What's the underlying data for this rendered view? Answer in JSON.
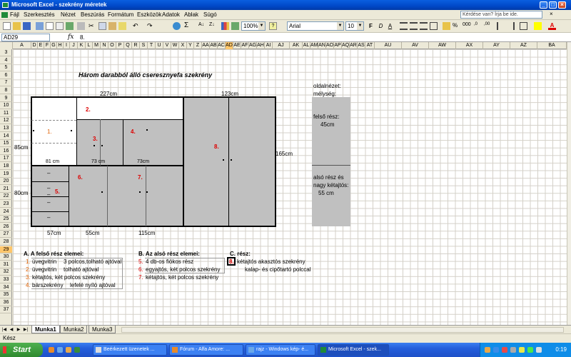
{
  "window": {
    "title": "Microsoft Excel - szekrény méretek"
  },
  "menu": {
    "items": [
      "Fájl",
      "Szerkesztés",
      "Nézet",
      "Beszúrás",
      "Formátum",
      "Eszközök",
      "Adatok",
      "Ablak",
      "Súgó"
    ],
    "help_placeholder": "Kérdése van? Írja be ide."
  },
  "toolbar": {
    "zoom": "100%",
    "font": "Arial",
    "font_size": "10",
    "bold": "F",
    "italic": "D",
    "underline": "A",
    "font_color_letter": "A"
  },
  "formula_bar": {
    "name_box": "AD29",
    "fx": "fx",
    "value": "8."
  },
  "columns": [
    "A",
    "D",
    "E",
    "F",
    "G",
    "H",
    "I",
    "J",
    "K",
    "L",
    "M",
    "N",
    "O",
    "P",
    "Q",
    "R",
    "S",
    "T",
    "U",
    "V",
    "W",
    "X",
    "Y",
    "Z",
    "AA",
    "AB",
    "AC",
    "AD",
    "AE",
    "AF",
    "AG",
    "AH",
    "AI",
    "AJ",
    "AK",
    "AL",
    "AM",
    "AN",
    "AO",
    "AP",
    "AQ",
    "AR",
    "AS",
    "AT",
    "AU",
    "AV",
    "AW",
    "AX",
    "AY",
    "AZ",
    "BA"
  ],
  "rows": [
    "3",
    "4",
    "5",
    "6",
    "7",
    "8",
    "9",
    "10",
    "11",
    "12",
    "13",
    "14",
    "15",
    "16",
    "17",
    "18",
    "19",
    "20",
    "21",
    "22",
    "23",
    "24",
    "25",
    "26",
    "27",
    "28",
    "29",
    "30",
    "31",
    "32",
    "33",
    "34",
    "35",
    "36",
    "37"
  ],
  "selected_row": "29",
  "sheet": {
    "title": "Három darabból álló cseresznyefa szekrény",
    "dims": {
      "top_left": "227cm",
      "top_right": "123cm",
      "left_upper": "85cm",
      "left_lower": "80cm",
      "right_height": "165cm",
      "w81": "81 cm",
      "w73a": "73 cm",
      "w73b": "73cm",
      "bottom_57": "57cm",
      "bottom_55": "55cm",
      "bottom_115": "115cm"
    },
    "labels": {
      "n1": "1.",
      "n2": "2.",
      "n3": "3.",
      "n4": "4.",
      "n5": "5.",
      "n6": "6.",
      "n7": "7.",
      "n8": "8."
    },
    "side_view": {
      "line1": "oldalnézet:",
      "line2": "mélység:",
      "upper1": "felső rész:",
      "upper2": "45cm",
      "lower1": "alsó rész  és",
      "lower2": "nagy kétajtós:",
      "lower3": "55 cm"
    },
    "drawer_dashes": [
      "–",
      "–",
      "–",
      "–",
      "–"
    ],
    "section_a": {
      "heading": "A. A felső rész elemei:",
      "items": [
        {
          "num": "1.",
          "text": "üvegvitrin",
          "extra": "3 polcos,tolható ajtóval"
        },
        {
          "num": "2.",
          "text": "üvegvitrin",
          "extra": "tolható ajtóval"
        },
        {
          "num": "3.",
          "text": "kétajtós, két polcos szekrény",
          "extra": ""
        },
        {
          "num": "4.",
          "text": "bárszekrény",
          "extra": "lefelé nyíló ajtóval"
        }
      ]
    },
    "section_b": {
      "heading": "B. Az alsó rész elemei:",
      "items": [
        {
          "num": "5.",
          "text": "4 db-os fiókos rész"
        },
        {
          "num": "6.",
          "text": "egyajtós, két polcos szekrény"
        },
        {
          "num": "7.",
          "text": "kétajtós, két polcos szekrény"
        }
      ]
    },
    "section_c": {
      "heading": "C. rész:",
      "num": "8.",
      "line1": "kétajtós akasztós szekrény",
      "line2": "kalap- és cipőtartó polccal"
    }
  },
  "tabs": [
    "Munka1",
    "Munka2",
    "Munka3"
  ],
  "status": "Kész",
  "taskbar": {
    "start": "Start",
    "tasks": [
      "Beérkezett üzenetek ...",
      "Fórum - Alfa Amore: ...",
      "rajz - Windows kép- é...",
      "Microsoft Excel - szek..."
    ],
    "clock": "0:19"
  },
  "colors": {
    "accent_red": "#dd0000",
    "accent_orange": "#e06000",
    "cabinet_gray": "#c0c0c0"
  }
}
